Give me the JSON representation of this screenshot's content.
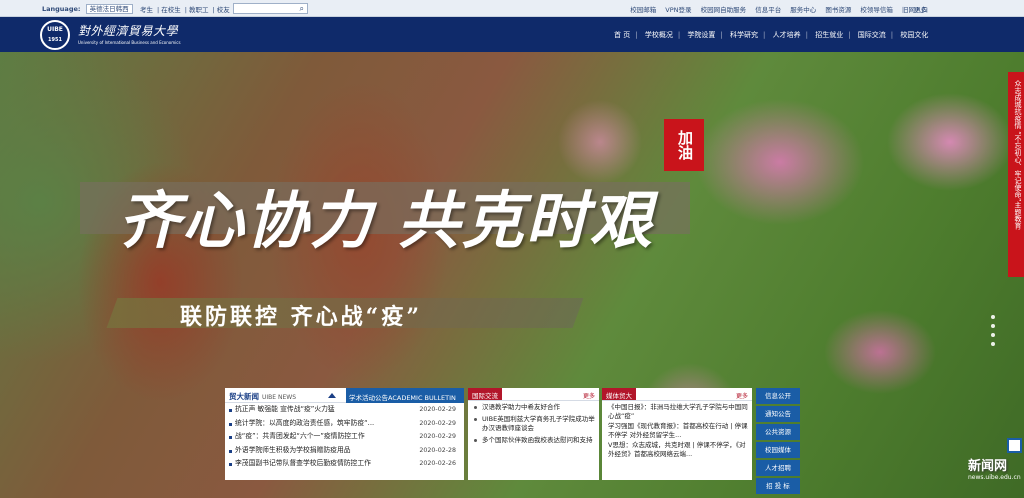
{
  "topbar": {
    "language_label": "Language:",
    "language_value": "英德法日韩西",
    "roles": [
      "考生",
      "在校生",
      "教职工",
      "校友"
    ],
    "links": [
      "校园邮箱",
      "VPN登录",
      "校园网自助服务",
      "信息平台",
      "服务中心",
      "图书资源",
      "校领导信箱",
      "旧网入口"
    ],
    "more": "更多"
  },
  "header": {
    "logo_seal_text": "UIBE",
    "logo_seal_year": "1951",
    "logo_name": "對外經濟貿易大學",
    "logo_en": "University of International Business and Economics",
    "nav": [
      "首 页",
      "学校概况",
      "学院设置",
      "科学研究",
      "人才培养",
      "招生就业",
      "国际交流",
      "校园文化"
    ]
  },
  "hero": {
    "slogan_main": "齐心协力 共克时艰",
    "jiayou": "加油",
    "slogan_sub": "联防联控  齐心战“疫”",
    "side_ribbon": "众志成城抗疫情 “不忘初心、牢记使命”主题教育"
  },
  "news_panel": {
    "tab_active": "贸大新闻",
    "tab_active_en": "UIBE NEWS",
    "tab_inactive": "学术活动公告ACADEMIC BULLETIN",
    "items": [
      {
        "title": "抗正声 敏强能 宣传战“疫”火力猛",
        "date": "2020-02-29"
      },
      {
        "title": "统计学院：以高度的政治责任感，筑牢防疫“...",
        "date": "2020-02-29"
      },
      {
        "title": "战“疫”：共青团发起“六个一”疫情防控工作",
        "date": "2020-02-29"
      },
      {
        "title": "外语学院师生积极为学校捐赠防疫用品",
        "date": "2020-02-28"
      },
      {
        "title": "李茂国副书记带队督查学校后勤疫情防控工作",
        "date": "2020-02-26"
      }
    ]
  },
  "intl_panel": {
    "title": "国际交流",
    "more": "更多",
    "items": [
      "汉语教学助力中希友好合作",
      "UIBE英国利兹大学商务孔子学院成功举办汉语教师座谈会",
      "多个国际伙伴致函我校表达慰问和支持"
    ]
  },
  "media_panel": {
    "title": "媒体贸大",
    "more": "更多",
    "items": [
      "《中国日报》：非洲马拉维大学孔子学院与中国同心战“疫”",
      "学习强国《现代教育报》：首都高校在行动 | 停课不停学 对外经贸留学生...",
      "V思想：众志成城，共克时艰 | 停课不停学，《对外经贸》首都高校网络云端..."
    ]
  },
  "quick_links": [
    "信息公开",
    "通知公告",
    "公共资源",
    "校园媒体",
    "人才招聘",
    "招 投 标"
  ],
  "watermark": "新闻网",
  "watermark_url": "news.uibe.edu.cn",
  "colors": {
    "header": "#0f2a6a",
    "accent_red": "#b2162a",
    "accent_blue": "#1a5da6"
  }
}
